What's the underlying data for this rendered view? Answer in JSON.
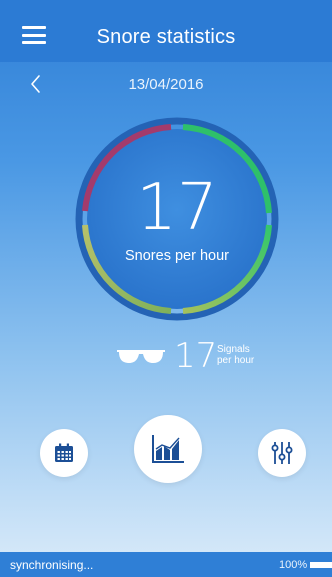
{
  "header": {
    "title": "Snore statistics",
    "menu_icon": "hamburger-menu-icon"
  },
  "date_nav": {
    "back_icon": "chevron-left-icon",
    "date": "13/04/2016"
  },
  "snores": {
    "value": "17",
    "label": "Snores per hour"
  },
  "signals": {
    "icon": "glasses-icon",
    "value": "17",
    "label_line1": "Signals",
    "label_line2": "per hour"
  },
  "actions": [
    {
      "name": "calendar",
      "icon": "calendar-icon"
    },
    {
      "name": "chart",
      "icon": "bar-chart-icon"
    },
    {
      "name": "settings",
      "icon": "sliders-icon"
    }
  ],
  "status": {
    "sync_text": "synchronising...",
    "battery_text": "100%",
    "battery_level": 1.0
  },
  "colors": {
    "header_bg": "#2c7bd4",
    "ring_red": "#a23a6a",
    "ring_green": "#2ec06a",
    "ring_yellow": "#9dbb62",
    "ring_track": "#1f5fb0",
    "icon_blue": "#1c4f96"
  }
}
